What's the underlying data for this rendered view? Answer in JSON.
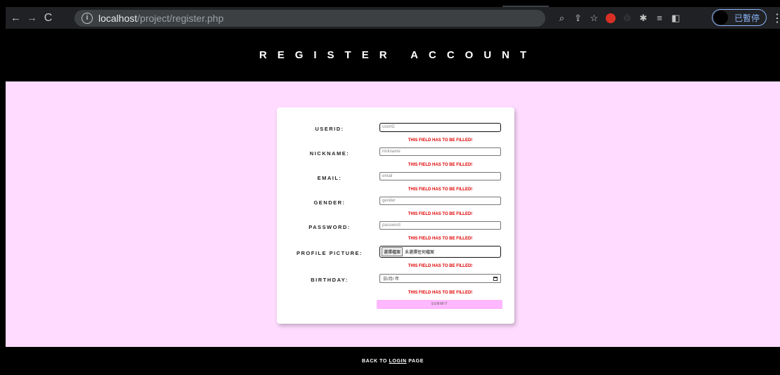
{
  "browser": {
    "url_host": "localhost",
    "url_path": "/project/register.php",
    "profile_label": "已暫停",
    "icons": [
      "back-arrow-icon",
      "forward-arrow-icon",
      "reload-icon",
      "info-icon",
      "zoom-icon",
      "share-icon",
      "star-icon",
      "extension-icon",
      "puzzle-icon",
      "reading-list-icon",
      "side-panel-icon",
      "menu-icon"
    ]
  },
  "page": {
    "title": "REGISTER ACCOUNT",
    "footer_prefix": "BACK TO ",
    "footer_link": "LOGIN",
    "footer_suffix": " PAGE"
  },
  "form": {
    "userid": {
      "label": "USERID:",
      "placeholder": "userID"
    },
    "nickname": {
      "label": "NICKNAME:",
      "placeholder": "nickname"
    },
    "email": {
      "label": "EMAIL:",
      "placeholder": "email"
    },
    "gender": {
      "label": "GENDER:",
      "placeholder": "gender"
    },
    "password": {
      "label": "PASSWORD:",
      "placeholder": "password"
    },
    "picture": {
      "label": "PROFILE PICTURE:",
      "button": "選擇檔案",
      "status": "未選擇任何檔案"
    },
    "birthday": {
      "label": "BIRTHDAY:",
      "value": "日/月/ 年"
    },
    "error": "THIS FIELD HAS TO BE FILLED!",
    "submit": "SUBMIT"
  },
  "colors": {
    "content_bg": "#ffdcff",
    "submit_bg": "#ffb7ff",
    "error": "#e00000"
  }
}
